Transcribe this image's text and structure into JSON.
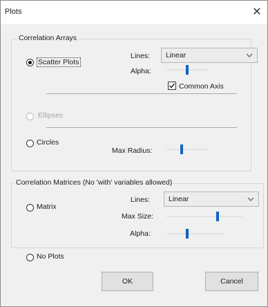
{
  "window": {
    "title": "Plots",
    "close_glyph": "✕"
  },
  "correlation_arrays": {
    "legend": "Correlation Arrays",
    "scatter_plots": {
      "label": "Scatter Plots",
      "selected": true
    },
    "lines_label": "Lines:",
    "lines_value": "Linear",
    "alpha_label": "Alpha:",
    "alpha_level": 0.5,
    "common_axis": {
      "label": "Common Axis",
      "checked": true
    },
    "ellipses": {
      "label": "Ellipses",
      "enabled": false
    },
    "circles": {
      "label": "Circles",
      "selected": false
    },
    "max_radius_label": "Max Radius:",
    "max_radius_level": 0.35
  },
  "correlation_matrices": {
    "legend": "Correlation Matrices (No 'with' variables allowed)",
    "matrix": {
      "label": "Matrix",
      "selected": false
    },
    "lines_label": "Lines:",
    "lines_value": "Linear",
    "max_size_label": "Max Size:",
    "max_size_level": 0.68,
    "alpha_label": "Alpha:",
    "alpha_level": 0.35
  },
  "no_plots": {
    "label": "No Plots",
    "selected": false
  },
  "buttons": {
    "ok": "OK",
    "cancel": "Cancel"
  },
  "icons": {
    "dropdown": "chevron-down-icon",
    "check": "checkmark-icon"
  }
}
